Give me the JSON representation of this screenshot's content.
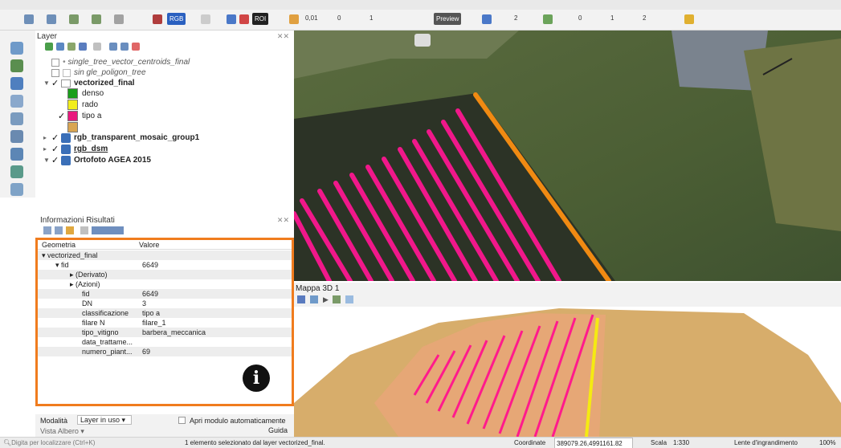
{
  "toolbar": {
    "rgb_label": "RGB",
    "roi_label": "ROI",
    "field1": "0,01",
    "field2": "0",
    "field3": "1",
    "preview_label": "Preview",
    "field4": "2",
    "field5": "0",
    "field6": "1",
    "field7": "2"
  },
  "layer_panel": {
    "title": "Layer",
    "layers": [
      {
        "label": "single_tree_vector_centroids_final",
        "checked": false
      },
      {
        "label": "sin gle_poligon_tree",
        "checked": false
      },
      {
        "label": "vectorized_final",
        "checked": true
      },
      {
        "label": "denso"
      },
      {
        "label": "rado"
      },
      {
        "label": "tipo a",
        "checked": true
      },
      {
        "label": ""
      },
      {
        "label": "rgb_transparent_mosaic_group1",
        "checked": true
      },
      {
        "label": "rgb_dsm",
        "checked": true
      },
      {
        "label": "Ortofoto AGEA 2015",
        "checked": true
      }
    ],
    "legend_colors": {
      "denso": "#1a9e1a",
      "rado": "#f2ee1c",
      "tipo_a": "#e8197e",
      "empty": "#d9a552"
    }
  },
  "info_panel": {
    "title": "Informazioni Risultati",
    "header": {
      "key": "Geometria",
      "value": "Valore"
    },
    "rows": [
      {
        "key": "vectorized_final",
        "value": ""
      },
      {
        "key": "fid",
        "value": "6649"
      },
      {
        "key": "(Derivato)",
        "value": ""
      },
      {
        "key": "(Azioni)",
        "value": ""
      },
      {
        "key": "fid",
        "value": "6649"
      },
      {
        "key": "DN",
        "value": "3"
      },
      {
        "key": "classificazione",
        "value": "tipo a"
      },
      {
        "key": "filare N",
        "value": "filare_1"
      },
      {
        "key": "tipo_vitigno",
        "value": "barbera_meccanica"
      },
      {
        "key": "data_trattame...",
        "value": ""
      },
      {
        "key": "numero_piant...",
        "value": "69"
      }
    ],
    "info_icon": "i"
  },
  "bottom_controls": {
    "mode_label": "Modalità",
    "mode_value": "Layer in uso",
    "auto_open_label": "Apri modulo automaticamente",
    "view_label": "Vista Albero",
    "guide_label": "Guida"
  },
  "map3d": {
    "title": "Mappa 3D 1"
  },
  "statusbar": {
    "locator_placeholder": "Digita per localizzare (Ctrl+K)",
    "message": "1 elemento selezionato dal layer vectorized_final.",
    "coord_label": "Coordinate",
    "coord_value": "389079.26,4991161.82",
    "scale_label": "Scala",
    "scale_value": "1:330",
    "magnifier_label": "Lente d'ingrandimento",
    "magnifier_value": "100%"
  },
  "colors": {
    "accent_orange": "#f07c1e",
    "row_pink": "#f0188a",
    "row_orange": "#f08a12",
    "field_green": "#4f6336",
    "terrain": "#d7ad6b"
  }
}
